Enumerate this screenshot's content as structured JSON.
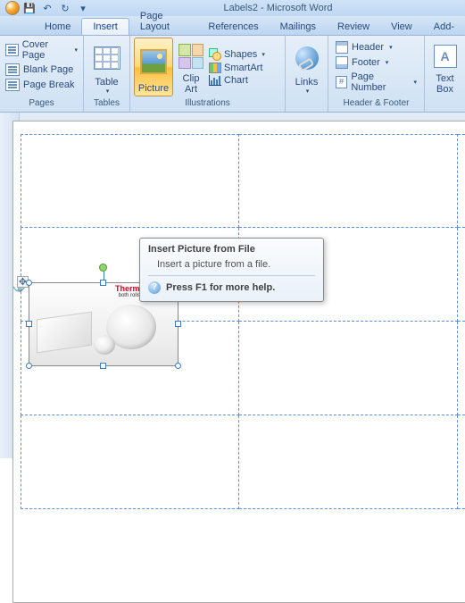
{
  "titlebar": {
    "title": "Labels2 - Microsoft Word"
  },
  "qat": {
    "save": "save",
    "undo": "↶",
    "redo": "↻"
  },
  "tabs": {
    "items": [
      {
        "label": "Home"
      },
      {
        "label": "Insert"
      },
      {
        "label": "Page Layout"
      },
      {
        "label": "References"
      },
      {
        "label": "Mailings"
      },
      {
        "label": "Review"
      },
      {
        "label": "View"
      },
      {
        "label": "Add-"
      }
    ],
    "activeIndex": 1
  },
  "ribbon": {
    "pages": {
      "label": "Pages",
      "cover": "Cover Page",
      "blank": "Blank Page",
      "break": "Page Break"
    },
    "tables": {
      "label": "Tables",
      "btn": "Table"
    },
    "illustrations": {
      "label": "Illustrations",
      "picture": "Picture",
      "clipart_l1": "Clip",
      "clipart_l2": "Art",
      "shapes": "Shapes",
      "smartart": "SmartArt",
      "chart": "Chart"
    },
    "links": {
      "label": "",
      "btn": "Links"
    },
    "headerfooter": {
      "label": "Header & Footer",
      "header": "Header",
      "footer": "Footer",
      "pagenum": "Page Number"
    },
    "text": {
      "label": "",
      "btn_l1": "Text",
      "btn_l2": "Box"
    }
  },
  "tooltip": {
    "title": "Insert Picture from File",
    "desc": "Insert a picture from a file.",
    "help": "Press F1 for more help."
  },
  "image": {
    "brand_l1": "Thermal Labels",
    "brand_l2": "both rolls and fanfolded"
  }
}
